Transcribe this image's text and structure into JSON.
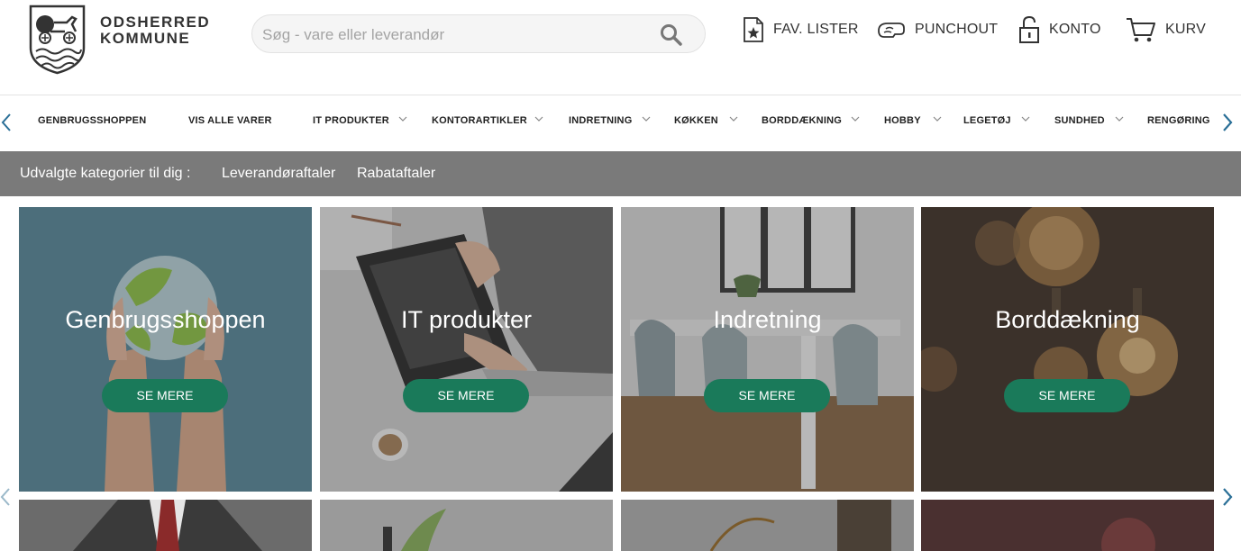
{
  "brand": {
    "line1": "ODSHERRED",
    "line2": "KOMMUNE"
  },
  "search": {
    "placeholder": "Søg - vare eller leverandør"
  },
  "header_links": [
    {
      "label": "FAV. LISTER",
      "icon": "star-list-icon"
    },
    {
      "label": "PUNCHOUT",
      "icon": "punchout-icon"
    },
    {
      "label": "KONTO",
      "icon": "lock-icon"
    },
    {
      "label": "KURV",
      "icon": "cart-icon"
    }
  ],
  "categories": [
    {
      "label": "GENBRUGSSHOPPEN",
      "dropdown": false
    },
    {
      "label": "VIS ALLE VARER",
      "dropdown": false
    },
    {
      "label": "IT PRODUKTER",
      "dropdown": true
    },
    {
      "label": "KONTORARTIKLER",
      "dropdown": true
    },
    {
      "label": "INDRETNING",
      "dropdown": true
    },
    {
      "label": "KØKKEN",
      "dropdown": true
    },
    {
      "label": "BORDDÆKNING",
      "dropdown": true
    },
    {
      "label": "HOBBY",
      "dropdown": true
    },
    {
      "label": "LEGETØJ",
      "dropdown": true
    },
    {
      "label": "SUNDHED",
      "dropdown": true
    },
    {
      "label": "RENGØRING",
      "dropdown": false
    }
  ],
  "selected_bar": {
    "label": "Udvalgte kategorier til dig :",
    "links": [
      "Leverandøraftaler",
      "Rabataftaler"
    ]
  },
  "tiles": [
    {
      "title": "Genbrugsshoppen",
      "button": "SE MERE"
    },
    {
      "title": "IT produkter",
      "button": "SE MERE"
    },
    {
      "title": "Indretning",
      "button": "SE MERE"
    },
    {
      "title": "Borddækning",
      "button": "SE MERE"
    }
  ],
  "colors": {
    "accent_green": "#1a7a5a",
    "bar_grey": "#7a7a7a",
    "arrow_blue": "#2a6f97"
  }
}
